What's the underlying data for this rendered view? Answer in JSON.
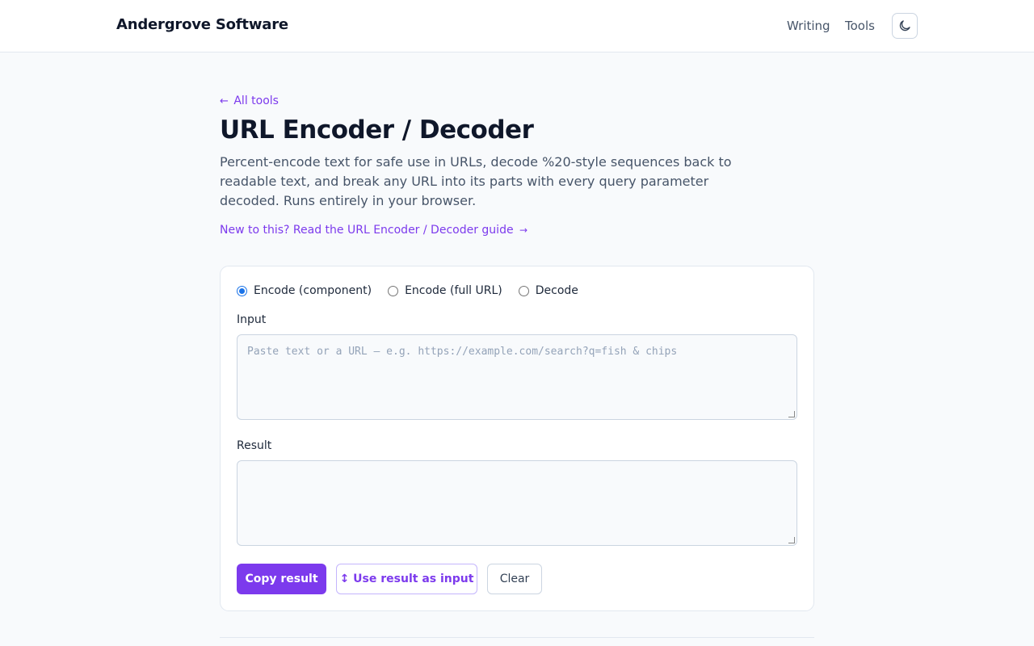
{
  "header": {
    "brand": "Andergrove Software",
    "nav": {
      "writing": "Writing",
      "tools": "Tools"
    },
    "theme_toggle_icon": "moon-icon"
  },
  "main": {
    "back_link": {
      "arrow": "←",
      "label": "All tools"
    },
    "title": "URL Encoder / Decoder",
    "description": "Percent-encode text for safe use in URLs, decode %20-style sequences back to readable text, and break any URL into its parts with every query parameter decoded. Runs entirely in your browser.",
    "guide_link": {
      "label": "New to this? Read the URL Encoder / Decoder guide",
      "arrow": "→"
    }
  },
  "tool": {
    "modes": [
      {
        "label": "Encode (component)",
        "checked": true
      },
      {
        "label": "Encode (full URL)",
        "checked": false
      },
      {
        "label": "Decode",
        "checked": false
      }
    ],
    "input_label": "Input",
    "input_placeholder": "Paste text or a URL — e.g. https://example.com/search?q=fish & chips",
    "input_value": "",
    "result_label": "Result",
    "result_value": "",
    "buttons": {
      "copy": "Copy result",
      "use_as_input": "↕ Use result as input",
      "clear": "Clear"
    }
  },
  "colors": {
    "accent": "#7c3aed",
    "radio_checked": "#1a73e8"
  }
}
